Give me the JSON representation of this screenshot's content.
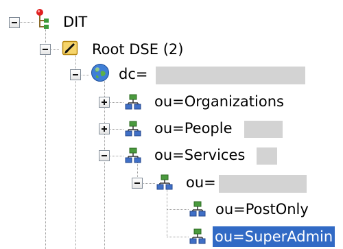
{
  "tree": {
    "root": {
      "label": "DIT",
      "icon": "dit-tree-icon"
    },
    "root_dse": {
      "label": "Root DSE (2)",
      "icon": "folder-icon"
    },
    "dc": {
      "label": "dc=",
      "icon": "globe-icon"
    },
    "organizations": {
      "label": "ou=Organizations",
      "icon": "org-unit-icon"
    },
    "people": {
      "label": "ou=People",
      "icon": "org-unit-icon"
    },
    "services": {
      "label": "ou=Services",
      "icon": "org-unit-icon"
    },
    "ou_hidden": {
      "label": "ou=",
      "icon": "org-unit-icon"
    },
    "post_only": {
      "label": "ou=PostOnly",
      "icon": "org-unit-icon"
    },
    "super_admin": {
      "label": "ou=SuperAdmin",
      "icon": "org-unit-icon",
      "selected": true
    }
  },
  "colors": {
    "selection": "#316ac5",
    "redaction": "#d3d3d3",
    "tree_lines": "#9a9a9a"
  }
}
